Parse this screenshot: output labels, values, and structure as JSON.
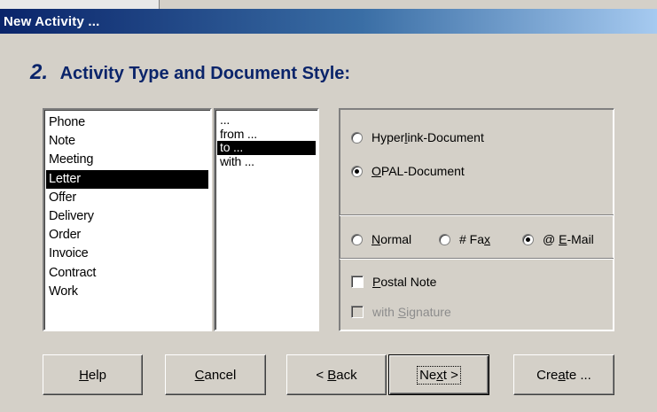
{
  "window": {
    "title": "New Activity ..."
  },
  "step": {
    "number": "2.",
    "title": "Activity Type and Document Style:"
  },
  "activity_types": {
    "items": [
      "Phone",
      "Note",
      "Meeting",
      "Letter",
      "Offer",
      "Delivery",
      "Order",
      "Invoice",
      "Contract",
      "Work"
    ],
    "selected": "Letter"
  },
  "directions": {
    "items": [
      "...",
      "from ...",
      "to ...",
      "with ..."
    ],
    "selected": "to ..."
  },
  "document_kind": {
    "options": [
      {
        "label": "Hyperlink-Document",
        "accel": "l",
        "checked": false
      },
      {
        "label": "OPAL-Document",
        "accel": "O",
        "checked": true
      }
    ]
  },
  "delivery": {
    "options": [
      {
        "prefix": "",
        "label": "Normal",
        "accel": "N",
        "checked": false
      },
      {
        "prefix": "# ",
        "label": "Fax",
        "accel": "x",
        "checked": false
      },
      {
        "prefix": "@ ",
        "label": "E-Mail",
        "accel": "E",
        "checked": true
      }
    ]
  },
  "checkboxes": {
    "postal_note": {
      "label": "Postal Note",
      "accel": "P",
      "checked": false,
      "enabled": true
    },
    "with_signature": {
      "label": "with Signature",
      "accel": "S",
      "checked": false,
      "enabled": false
    }
  },
  "buttons": {
    "help": {
      "label": "Help",
      "accel": "H"
    },
    "cancel": {
      "label": "Cancel",
      "accel": "C"
    },
    "back": {
      "label": "< Back",
      "accel": "B"
    },
    "next": {
      "label": "Next >",
      "accel": "x",
      "default": true
    },
    "create": {
      "label": "Create ...",
      "accel": "a"
    }
  }
}
